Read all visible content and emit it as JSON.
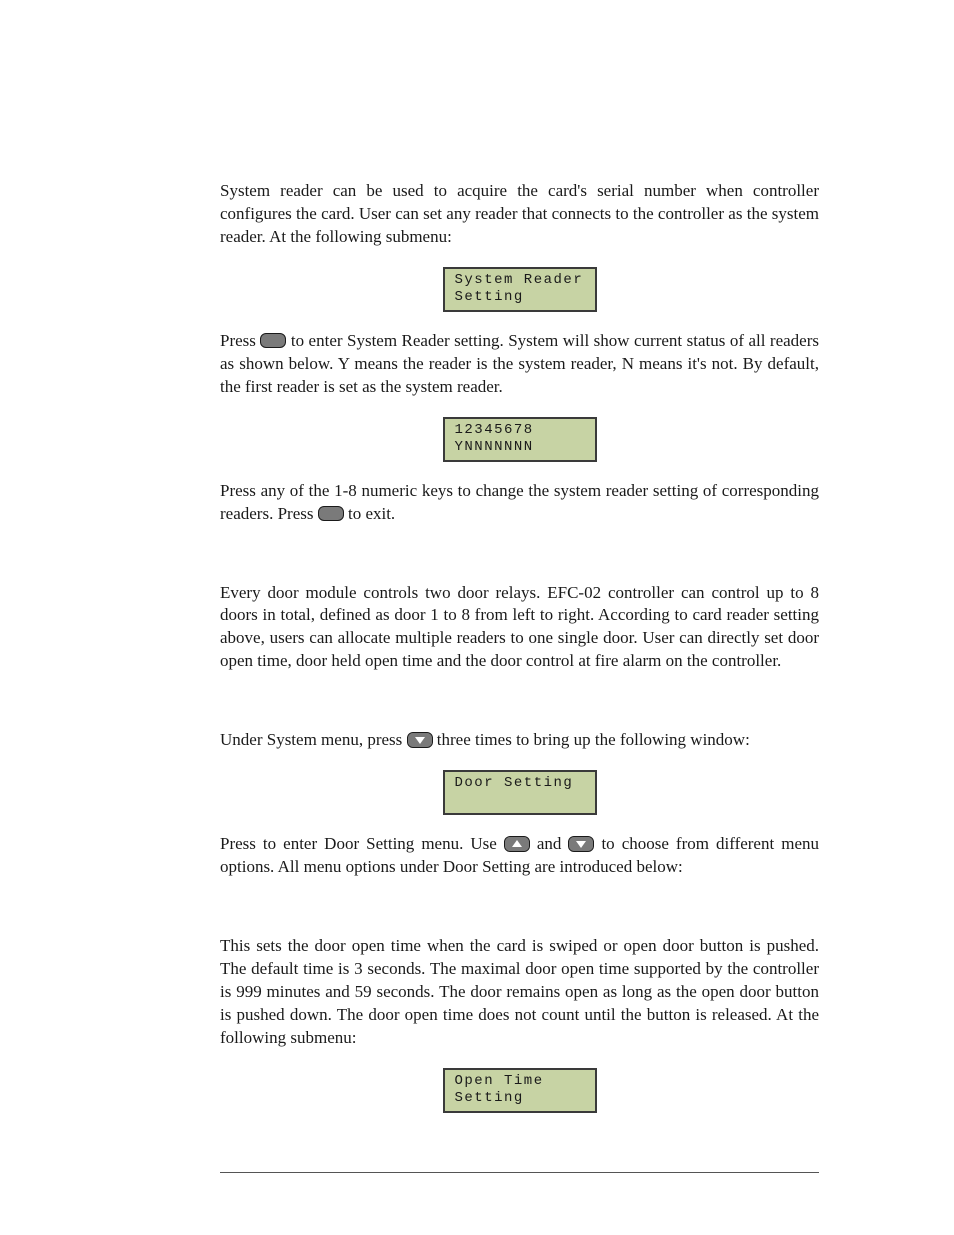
{
  "para1": "System reader can be used to acquire the card's serial number when controller configures the card. User can set any reader that connects to the controller as the system reader. At the following submenu:",
  "lcd1": {
    "line1": "System Reader",
    "line2": "Setting"
  },
  "para2a": "Press ",
  "para2b": " to enter System Reader setting. System will show current status of all readers as shown below. Y means the reader is the system reader, N means it's not. By default, the first reader is set as the system reader.",
  "lcd2": {
    "line1": "12345678",
    "line2": "YNNNNNNN"
  },
  "para3a": "Press any of the 1-8 numeric keys to change the system reader setting of corresponding readers. Press ",
  "para3b": " to exit.",
  "para4": "Every door module controls two door relays. EFC-02 controller can control up to 8 doors in total, defined as door 1 to 8 from left to right. According to card reader setting above, users can allocate multiple readers to one single door. User can directly set door open time, door held open time and the door control at fire alarm on the controller.",
  "para5a": "Under System menu, press ",
  "para5b": " three times to bring up the following window:",
  "lcd3": {
    "line1": "Door Setting",
    "line2": " "
  },
  "para6a": "Press to enter Door Setting menu. Use ",
  "para6b": " and ",
  "para6c": " to choose from different menu options. All menu options under Door Setting are introduced below:",
  "para7": "This sets the door open time when the card is swiped or open door button is pushed. The default time is 3 seconds. The maximal door open time supported by the controller is 999 minutes and 59 seconds. The door remains open as long as the open door button is pushed down. The door open time does not count until the button is released.  At the following submenu:",
  "lcd4": {
    "line1": "Open Time",
    "line2": "Setting"
  }
}
